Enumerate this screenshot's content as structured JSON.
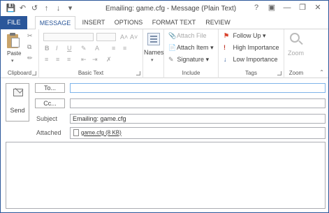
{
  "window": {
    "title": "Emailing: game.cfg - Message (Plain Text)"
  },
  "quick_access": {
    "save_icon": "save-icon",
    "undo_icon": "undo-icon",
    "redo_icon": "redo-icon",
    "up_icon": "up-arrow-icon",
    "down_icon": "down-arrow-icon",
    "customize_icon": "dropdown-icon"
  },
  "window_controls": {
    "help": "?",
    "ribbon_options": "ribbon-display-options-icon",
    "minimize": "minimize-icon",
    "restore": "restore-icon",
    "close": "close-icon"
  },
  "tabs": [
    "FILE",
    "MESSAGE",
    "INSERT",
    "OPTIONS",
    "FORMAT TEXT",
    "REVIEW"
  ],
  "ribbon": {
    "clipboard": {
      "label": "Clipboard",
      "paste": "Paste"
    },
    "basic_text": {
      "label": "Basic Text"
    },
    "names": {
      "label": "Names"
    },
    "include": {
      "label": "Include",
      "attach_file": "Attach File",
      "attach_item": "Attach Item",
      "signature": "Signature"
    },
    "tags": {
      "label": "Tags",
      "follow_up": "Follow Up",
      "high_importance": "High Importance",
      "low_importance": "Low Importance"
    },
    "zoom": {
      "label": "Zoom",
      "zoom": "Zoom"
    }
  },
  "compose": {
    "send": "Send",
    "to_button": "To...",
    "cc_button": "Cc...",
    "to_value": "",
    "cc_value": "",
    "subject_label": "Subject",
    "subject_value": "Emailing: game.cfg",
    "attached_label": "Attached",
    "attachment": "game.cfg (8 KB)",
    "body_value": ""
  },
  "colors": {
    "accent": "#2b579a",
    "high_importance": "#c0392b",
    "low_importance": "#2b579a",
    "follow_up_flag": "#d9412b"
  }
}
